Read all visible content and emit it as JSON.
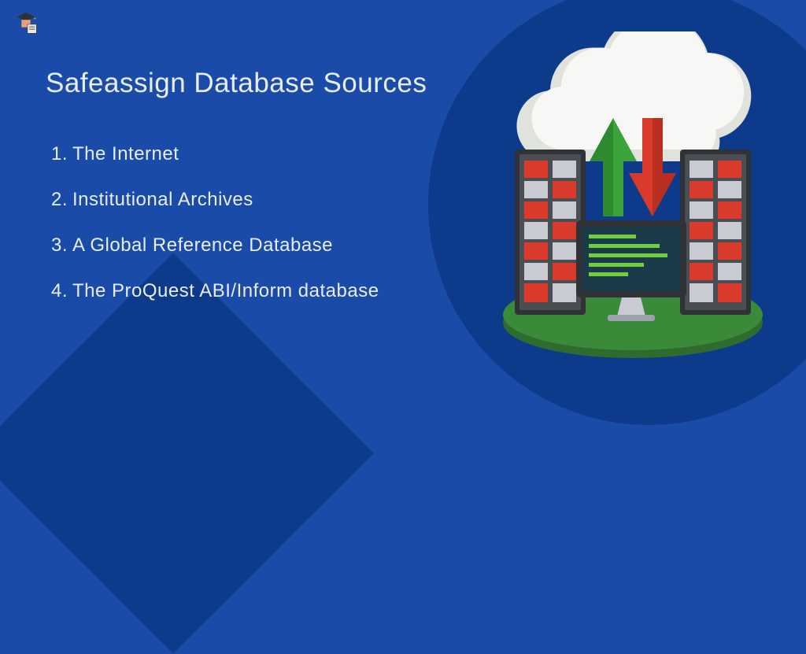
{
  "title": "Safeassign Database Sources",
  "sources": [
    "The Internet",
    "Institutional Archives",
    "A Global Reference Database",
    "The ProQuest ABI/Inform database"
  ],
  "colors": {
    "bg": "#1a4ba8",
    "bg_accent": "#0d3a8a",
    "text": "#e8edf7",
    "cloud": "#f7f8f6",
    "cloud_shadow": "#dfe3dc",
    "arrow_up": "#3aa43a",
    "arrow_down": "#d93a2b",
    "server_body": "#4a4d52",
    "server_dark": "#2f3237",
    "server_panel_red": "#d93a2b",
    "server_panel_light": "#c8ccd2",
    "monitor_frame": "#2f3237",
    "monitor_screen": "#1b3a4a",
    "monitor_text": "#6fcf3c",
    "platform": "#3a8a3a"
  },
  "icons": {
    "logo": "graduation-scholar-icon",
    "cloud": "cloud-icon",
    "arrow_up": "upload-arrow-icon",
    "arrow_down": "download-arrow-icon",
    "server": "server-rack-icon",
    "monitor": "computer-monitor-icon"
  }
}
